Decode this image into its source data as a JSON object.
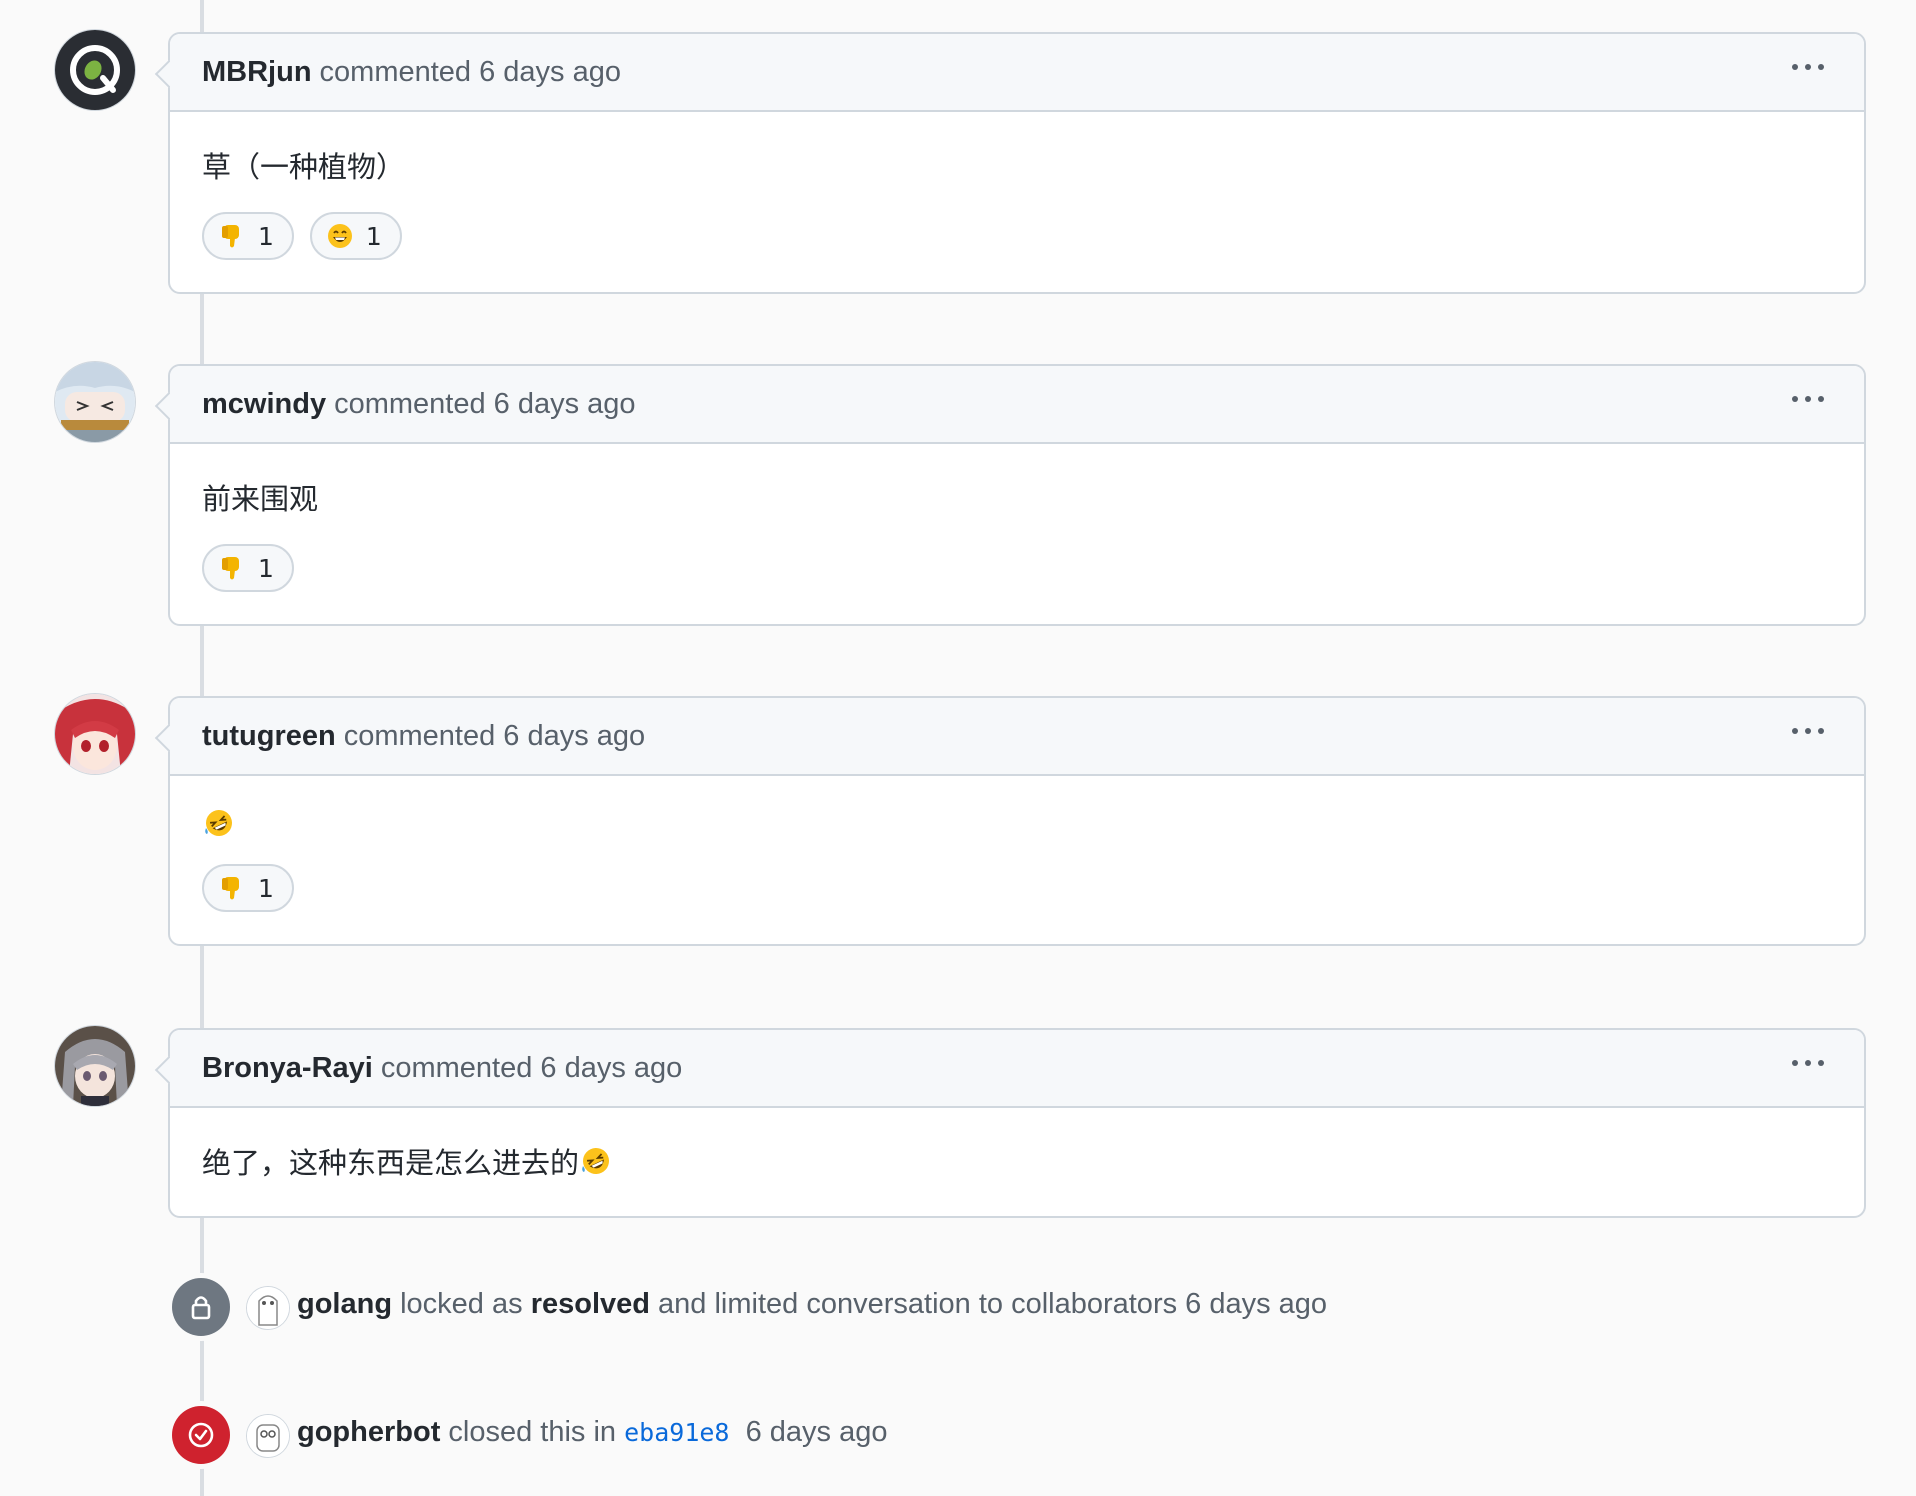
{
  "colors": {
    "lock_badge": "#6e7781",
    "closed_badge": "#cf222e",
    "link": "#0969da",
    "header_bg": "#f6f8fa",
    "border": "#d0d7de"
  },
  "comments": [
    {
      "author": "MBRjun",
      "meta": "commented 6 days ago",
      "body": "草（一种植物）",
      "reactions": [
        {
          "icon": "thumbs-down-icon",
          "count": "1"
        },
        {
          "icon": "laugh-icon",
          "count": "1"
        }
      ]
    },
    {
      "author": "mcwindy",
      "meta": "commented 6 days ago",
      "body": "前来围观",
      "reactions": [
        {
          "icon": "thumbs-down-icon",
          "count": "1"
        }
      ]
    },
    {
      "author": "tutugreen",
      "meta": "commented 6 days ago",
      "body": "",
      "body_emoji": "rolling-on-floor-laughing-icon",
      "reactions": [
        {
          "icon": "thumbs-down-icon",
          "count": "1"
        }
      ]
    },
    {
      "author": "Bronya-Rayi",
      "meta": "commented 6 days ago",
      "body": "绝了，这种东西是怎么进去的",
      "body_emoji": "rolling-on-floor-laughing-icon",
      "reactions": []
    }
  ],
  "events": {
    "locked": {
      "icon": "lock-icon",
      "actor": "golang",
      "text_1": " locked as ",
      "reason": "resolved",
      "text_2": " and limited conversation to collaborators 6 days ago"
    },
    "closed": {
      "icon": "check-circle-icon",
      "actor": "gopherbot",
      "text_1": " closed this in ",
      "commit": "eba91e8",
      "text_2": "  6 days ago"
    }
  }
}
